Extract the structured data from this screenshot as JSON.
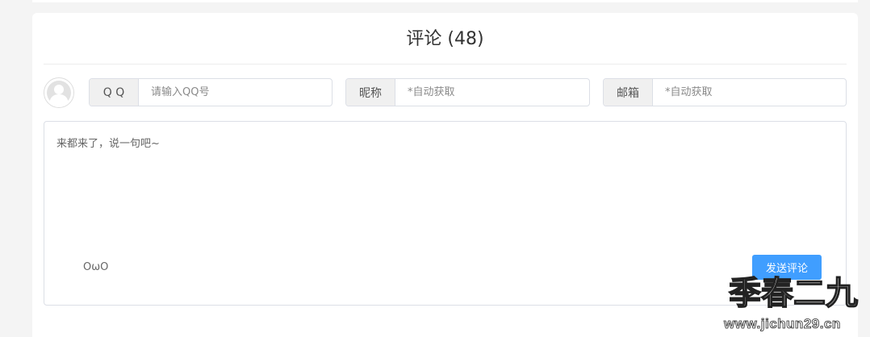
{
  "comments": {
    "title": "评论 (48)"
  },
  "form": {
    "qq": {
      "label": "Q Q",
      "placeholder": "请输入QQ号"
    },
    "nickname": {
      "label": "昵称",
      "placeholder": "*自动获取"
    },
    "email": {
      "label": "邮箱",
      "placeholder": "*自动获取"
    },
    "comment": {
      "placeholder": "来都来了，说一句吧~"
    },
    "emoji_label": "OωO",
    "submit_label": "发送评论"
  },
  "icons": {
    "avatar": "default-user-avatar-icon"
  },
  "colors": {
    "accent": "#409eff",
    "page_bg": "#f4f4f4",
    "label_bg": "#f0f0f0"
  },
  "watermark": {
    "title": "季春二九",
    "url": "www.jichun29.cn"
  }
}
